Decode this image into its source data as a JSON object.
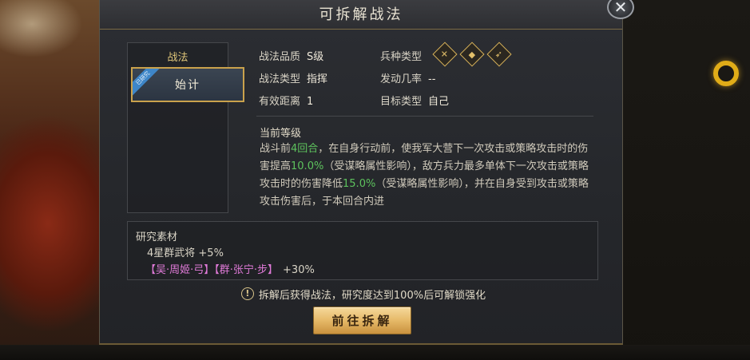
{
  "dialog": {
    "title": "可拆解战法",
    "close_glyph": "✕"
  },
  "tactic_list": {
    "header": "战法",
    "items": [
      {
        "label": "始计",
        "ribbon": "已研究",
        "selected": true
      }
    ]
  },
  "info": {
    "quality_label": "战法品质",
    "quality_value": "S级",
    "type_label": "战法类型",
    "type_value": "指挥",
    "range_label": "有效距离",
    "range_value": "1",
    "troop_label": "兵种类型",
    "troop_icons": [
      "cavalry-icon",
      "shield-icon",
      "bow-icon"
    ],
    "rate_label": "发动几率",
    "rate_value": "--",
    "target_label": "目标类型",
    "target_value": "自己"
  },
  "description": {
    "heading": "当前等级",
    "p1": "战斗前",
    "rounds": "4回合",
    "p2": "，在自身行动前，使我军大营下一次攻击或策略攻击时的伤害提高",
    "boost": "10.0%",
    "p3": "（受谋略属性影响），敌方兵力最多单体下一次攻击或策略攻击时的伤害降低",
    "reduce": "15.0%",
    "p4": "（受谋略属性影响），并在自身受到攻击或策略攻击伤害后，于本回合内进"
  },
  "materials": {
    "title": "研究素材",
    "line1": "4星群武将 +5%",
    "hero1": "【吴·周姬·弓】",
    "hero2": "【群·张宁·步】",
    "bonus2": "+30%"
  },
  "hint": {
    "icon": "!",
    "text": "拆解后获得战法，研究度达到100%后可解锁强化"
  },
  "actions": {
    "go_label": "前往拆解"
  },
  "colors": {
    "accent_gold": "#caa24c",
    "highlight_green": "#5dc25d",
    "hero_pink": "#e07ad8",
    "ribbon_blue": "#3e86c8"
  }
}
